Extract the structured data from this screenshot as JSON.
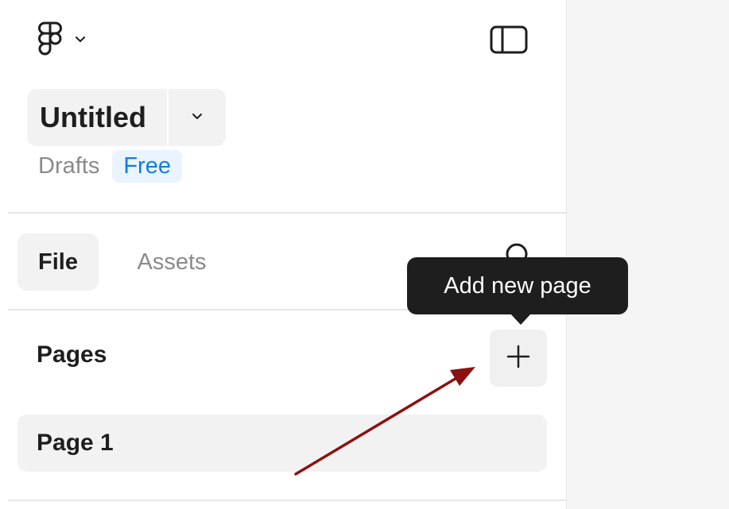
{
  "header": {
    "logo_icon": "figma-logo-icon",
    "logo_menu_icon": "chevron-down-icon",
    "panel_toggle_icon": "sidebar-panel-icon"
  },
  "file": {
    "title": "Untitled",
    "title_menu_icon": "chevron-down-icon",
    "location": "Drafts",
    "plan_badge": "Free"
  },
  "tabs": [
    {
      "label": "File",
      "active": true
    },
    {
      "label": "Assets",
      "active": false
    }
  ],
  "search_icon": "search-icon",
  "pages": {
    "title": "Pages",
    "add_icon": "plus-icon",
    "items": [
      {
        "label": "Page 1",
        "selected": true
      }
    ]
  },
  "tooltip": {
    "text": "Add new page"
  },
  "annotation": {
    "type": "arrow",
    "color": "#8b1111"
  },
  "colors": {
    "accent": "#0d7de8",
    "badge_bg": "#eaf4ff",
    "tooltip_bg": "#1e1e1e",
    "canvas_bg": "#f5f5f5"
  }
}
